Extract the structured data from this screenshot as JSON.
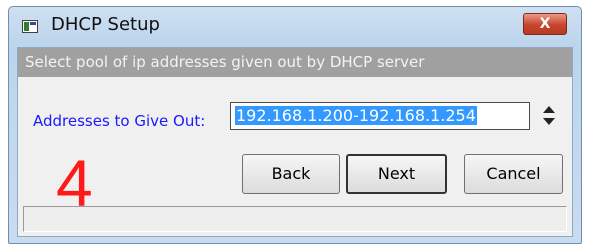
{
  "window": {
    "title": "DHCP Setup",
    "close_label": "X",
    "banner_text": "Select pool of ip addresses given out by DHCP server"
  },
  "form": {
    "label": "Addresses to Give Out:",
    "value": "192.168.1.200-192.168.1.254"
  },
  "buttons": {
    "back": "Back",
    "next": "Next",
    "cancel": "Cancel"
  },
  "annotation": {
    "text": "4",
    "color": "#ff1a1a"
  },
  "colors": {
    "banner_bg": "#a0a0a0",
    "label_color": "#1a1aff",
    "selection_bg": "#3399ff",
    "close_button": "#c8452c"
  }
}
